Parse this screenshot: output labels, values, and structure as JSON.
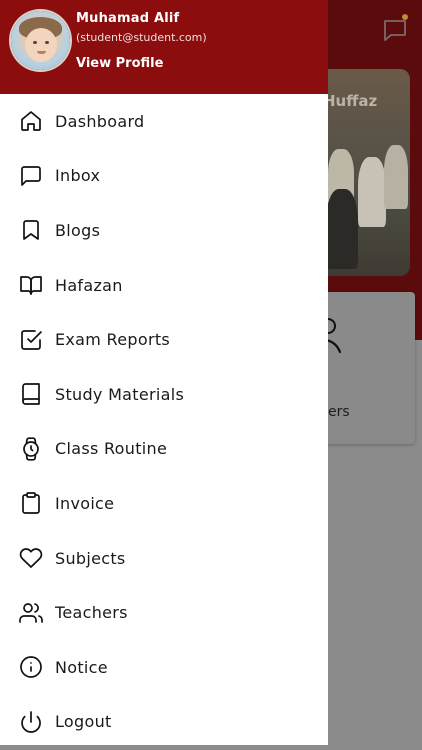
{
  "background": {
    "banner_title": "Huffaz",
    "card_text": "ers"
  },
  "colors": {
    "drawer_header": "#8b0d0d",
    "background_header": "#5b0b0b",
    "background_body": "#8b8b8b",
    "drawer_body": "#ffffff"
  },
  "drawer": {
    "user": {
      "name": "Muhamad Alif",
      "email": "(student@student.com)",
      "view_profile": "View Profile"
    },
    "menu": [
      {
        "label": "Dashboard",
        "icon": "home-icon"
      },
      {
        "label": "Inbox",
        "icon": "message-square-icon"
      },
      {
        "label": "Blogs",
        "icon": "bookmark-icon"
      },
      {
        "label": "Hafazan",
        "icon": "book-open-icon"
      },
      {
        "label": "Exam Reports",
        "icon": "check-square-icon"
      },
      {
        "label": "Study Materials",
        "icon": "book-icon"
      },
      {
        "label": "Class Routine",
        "icon": "watch-icon"
      },
      {
        "label": "Invoice",
        "icon": "clipboard-icon"
      },
      {
        "label": "Subjects",
        "icon": "heart-icon"
      },
      {
        "label": "Teachers",
        "icon": "users-icon"
      },
      {
        "label": "Notice",
        "icon": "info-icon"
      },
      {
        "label": "Logout",
        "icon": "power-icon"
      }
    ]
  }
}
